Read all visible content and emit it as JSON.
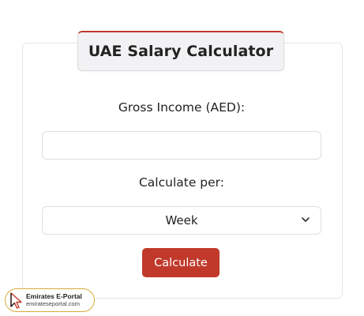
{
  "calculator": {
    "title": "UAE Salary Calculator",
    "gross_income_label": "Gross Income (AED):",
    "gross_income_value": "",
    "gross_income_placeholder": "",
    "calculate_per_label": "Calculate per:",
    "calculate_per_selected": "Week",
    "calculate_button": "Calculate"
  },
  "watermark": {
    "brand": "Emirates E-Portal",
    "url": "emirateseportal.com"
  },
  "colors": {
    "accent": "#c0392b",
    "logo_border": "#d8a93a"
  },
  "icons": {
    "select_chevron": "chevron-down-icon",
    "logo_cursor": "cursor-arrow-icon"
  }
}
